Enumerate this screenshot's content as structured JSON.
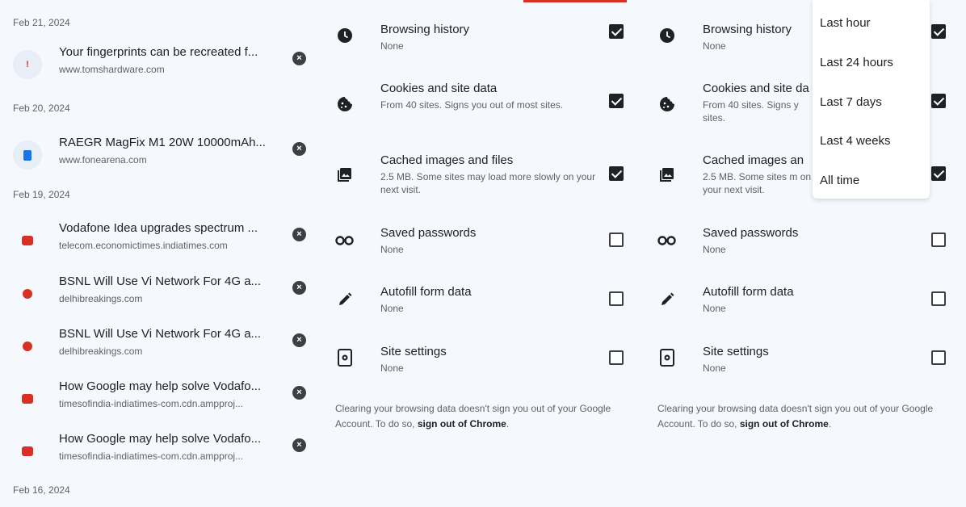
{
  "history": {
    "groups": [
      {
        "date": "Feb 21, 2024",
        "items": [
          {
            "title": "Your fingerprints can be recreated f...",
            "url": "www.tomshardware.com",
            "favicon": "exclamation-icon"
          }
        ]
      },
      {
        "date": "Feb 20, 2024",
        "items": [
          {
            "title": "RAEGR MagFix M1 20W 10000mAh...",
            "url": "www.fonearena.com",
            "favicon": "book-icon"
          }
        ]
      },
      {
        "date": "Feb 19, 2024",
        "items": [
          {
            "title": "Vodafone Idea upgrades spectrum ...",
            "url": "telecom.economictimes.indiatimes.com",
            "favicon": "red-square-icon"
          },
          {
            "title": "BSNL Will Use Vi Network For 4G a...",
            "url": "delhibreakings.com",
            "favicon": "red-dot-icon"
          },
          {
            "title": "BSNL Will Use Vi Network For 4G a...",
            "url": "delhibreakings.com",
            "favicon": "red-dot-icon"
          },
          {
            "title": "How Google may help solve Vodafo...",
            "url": "timesofindia-indiatimes-com.cdn.ampproj...",
            "favicon": "red-square-icon"
          },
          {
            "title": "How Google may help solve Vodafo...",
            "url": "timesofindia-indiatimes-com.cdn.ampproj...",
            "favicon": "red-square-icon"
          }
        ]
      },
      {
        "date": "Feb 16, 2024",
        "items": []
      }
    ],
    "remove_icon": "close-circle-icon"
  },
  "clear_data": {
    "rows": [
      {
        "title": "Browsing history",
        "subtitle": "None",
        "checked": true,
        "icon": "clock-icon"
      },
      {
        "title": "Cookies and site data",
        "subtitle": "From 40 sites. Signs you out of most sites.",
        "checked": true,
        "icon": "cookie-icon"
      },
      {
        "title": "Cached images and files",
        "subtitle": "2.5 MB. Some sites may load more slowly on your next visit.",
        "checked": true,
        "icon": "image-icon"
      },
      {
        "title": "Saved passwords",
        "subtitle": "None",
        "checked": false,
        "icon": "key-icon"
      },
      {
        "title": "Autofill form data",
        "subtitle": "None",
        "checked": false,
        "icon": "pencil-icon"
      },
      {
        "title": "Site settings",
        "subtitle": "None",
        "checked": false,
        "icon": "site-settings-icon"
      }
    ],
    "footer": {
      "text": "Clearing your browsing data doesn't sign you out of your Google Account. To do so, ",
      "link": "sign out of Chrome",
      "end": "."
    }
  },
  "clear_data_right": {
    "rows": [
      {
        "title": "Browsing history",
        "subtitle": "None",
        "checked": true,
        "icon": "clock-icon"
      },
      {
        "title": "Cookies and site da",
        "subtitle": "From 40 sites. Signs y sites.",
        "checked": true,
        "icon": "cookie-icon"
      },
      {
        "title": "Cached images an",
        "subtitle": "2.5 MB. Some sites m on your next visit.",
        "checked": true,
        "icon": "image-icon"
      },
      {
        "title": "Saved passwords",
        "subtitle": "None",
        "checked": false,
        "icon": "key-icon"
      },
      {
        "title": "Autofill form data",
        "subtitle": "None",
        "checked": false,
        "icon": "pencil-icon"
      },
      {
        "title": "Site settings",
        "subtitle": "None",
        "checked": false,
        "icon": "site-settings-icon"
      }
    ]
  },
  "time_range_menu": {
    "options": [
      "Last hour",
      "Last 24 hours",
      "Last 7 days",
      "Last 4 weeks",
      "All time"
    ]
  },
  "colors": {
    "background": "#f5f8fc",
    "accent": "#d93025",
    "checkbox_checked": "#202124"
  }
}
